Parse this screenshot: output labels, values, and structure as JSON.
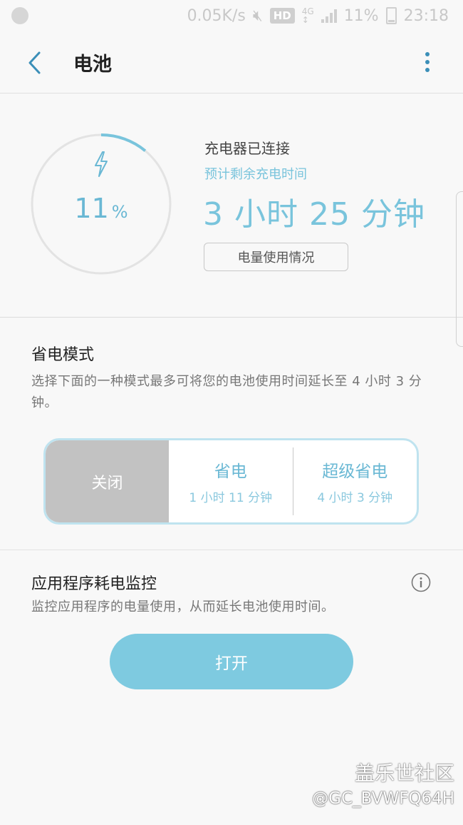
{
  "status_bar": {
    "speed": "0.05K/s",
    "hd": "HD",
    "network": "4G",
    "battery": "11%",
    "time": "23:18"
  },
  "app_bar": {
    "title": "电池"
  },
  "battery": {
    "percent": "11",
    "percent_unit": "%",
    "level_fraction": 0.11,
    "charger_status": "充电器已连接",
    "estimate_label": "预计剩余充电时间",
    "estimate_time": "3 小时 25 分钟",
    "usage_button": "电量使用情况"
  },
  "power_saving": {
    "title": "省电模式",
    "description": "选择下面的一种模式最多可将您的电池使用时间延长至 4 小时 3 分钟。",
    "off_label": "关闭",
    "modes": [
      {
        "name": "省电",
        "time": "1 小时 11 分钟"
      },
      {
        "name": "超级省电",
        "time": "4 小时 3 分钟"
      }
    ]
  },
  "app_monitor": {
    "title": "应用程序耗电监控",
    "description": "监控应用程序的电量使用，从而延长电池使用时间。",
    "button": "打开"
  },
  "watermark": {
    "line1": "盖乐世社区",
    "line2": "@GC_BVWFQ64H"
  },
  "colors": {
    "accent": "#6ab8d4",
    "button": "#7ecae0",
    "off": "#c2c2c2"
  }
}
